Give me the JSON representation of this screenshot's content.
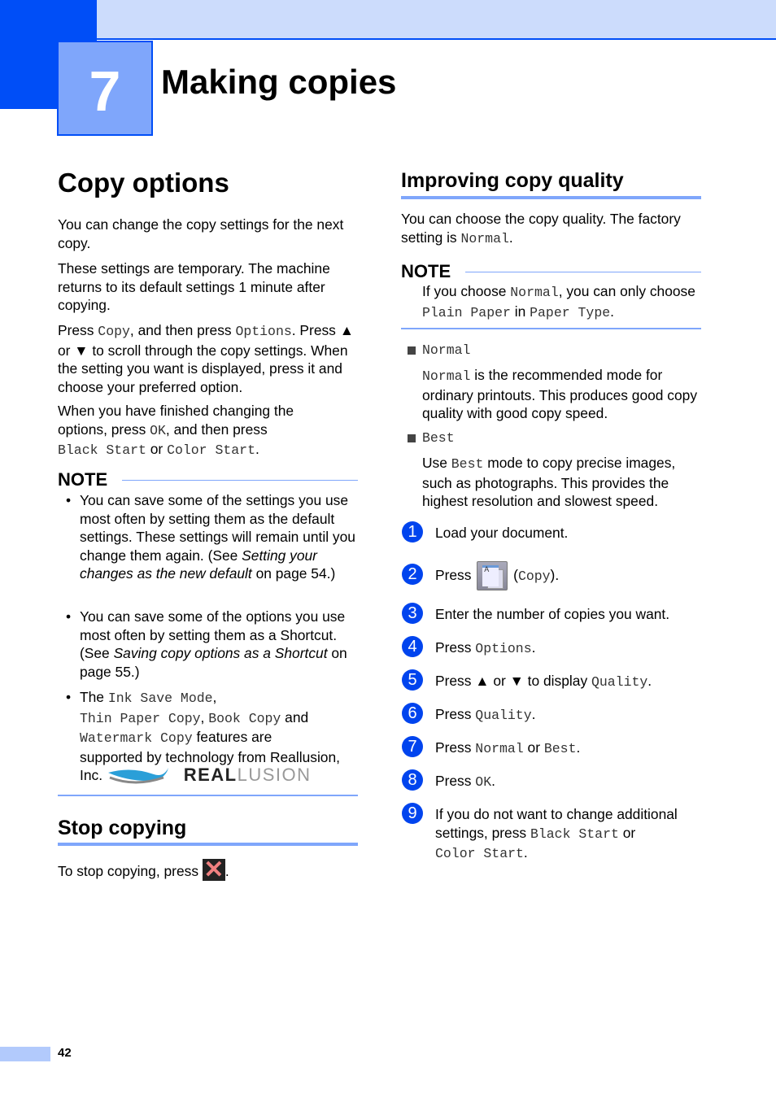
{
  "chapter": {
    "number": "7",
    "title": "Making copies"
  },
  "left": {
    "heading": "Copy options",
    "p1": "You can change the copy settings for the next copy.",
    "p2": "These settings are temporary. The machine returns to its default settings 1 minute after copying.",
    "p3": {
      "a": "Press ",
      "b": "Copy",
      "c": ", and then press ",
      "d": "Options",
      "e": ". Press",
      "f": "▲ or ▼ to scroll through the copy settings. When the setting you want is displayed, press it and choose your preferred option."
    },
    "p4": {
      "a": "When you have finished changing the options, press ",
      "b": "OK",
      "c": ", and then press",
      "d": "Black Start",
      "e": " or ",
      "f": "Color Start",
      "g": "."
    },
    "note": {
      "title": "NOTE",
      "b1": {
        "a": "You can save some of the settings you use most often by setting them as the default settings. These settings will remain until you change them again. (See ",
        "b": "Setting your changes as the new default",
        "c": " on page 54.)"
      },
      "b2": {
        "a": "You can save some of the options you use most often by setting them as a Shortcut. (See ",
        "b": "Saving copy options as a Shortcut",
        "c": " on page 55.)"
      },
      "b3": {
        "a": "The ",
        "b": "Ink Save Mode",
        "c": ",",
        "d": "Thin Paper Copy",
        "e": ", ",
        "f": "Book Copy",
        "g": " and",
        "h": "Watermark Copy",
        "i": " features are",
        "j": "supported by technology from Reallusion,",
        "k": "Inc."
      },
      "logo": {
        "a": "REAL",
        "b": "LUSION"
      }
    },
    "stop": {
      "heading": "Stop copying",
      "text": "To stop copying, press ",
      "end": "."
    }
  },
  "right": {
    "heading": "Improving copy quality",
    "p1": {
      "a": "You can choose the copy quality. The factory setting is ",
      "b": "Normal",
      "c": "."
    },
    "note": {
      "title": "NOTE",
      "a": "If you choose ",
      "b": "Normal",
      "c": ", you can only choose ",
      "d": "Plain Paper",
      "e": " in ",
      "f": "Paper Type",
      "g": "."
    },
    "options": [
      {
        "name": "Normal",
        "desc_mono": "Normal",
        "desc": " is the recommended mode for ordinary printouts. This produces good copy quality with good copy speed."
      },
      {
        "name": "Best",
        "desc_pre": "Use ",
        "desc_mono": "Best",
        "desc": " mode to copy precise images, such as photographs. This provides the highest resolution and slowest speed."
      }
    ],
    "steps": [
      {
        "n": "1",
        "text": "Load your document."
      },
      {
        "n": "2",
        "a": "Press ",
        "b": "(",
        "c": "Copy",
        "d": ")."
      },
      {
        "n": "3",
        "text": "Enter the number of copies you want."
      },
      {
        "n": "4",
        "a": "Press ",
        "b": "Options",
        "c": "."
      },
      {
        "n": "5",
        "a": "Press ▲ or ▼ to display ",
        "b": "Quality",
        "c": "."
      },
      {
        "n": "6",
        "a": "Press ",
        "b": "Quality",
        "c": "."
      },
      {
        "n": "7",
        "a": "Press ",
        "b": "Normal",
        "c": " or ",
        "d": "Best",
        "e": "."
      },
      {
        "n": "8",
        "a": "Press ",
        "b": "OK",
        "c": "."
      },
      {
        "n": "9",
        "a": "If you do not want to change additional settings, press ",
        "b": "Black Start",
        "c": " or",
        "d": "Color Start",
        "e": "."
      }
    ]
  },
  "footer": {
    "page": "42"
  },
  "colors": {
    "accent": "#004ef7",
    "accent_light": "#7fa6fb",
    "header_light": "#ccdcfc",
    "step_badge": "#0044ee"
  }
}
